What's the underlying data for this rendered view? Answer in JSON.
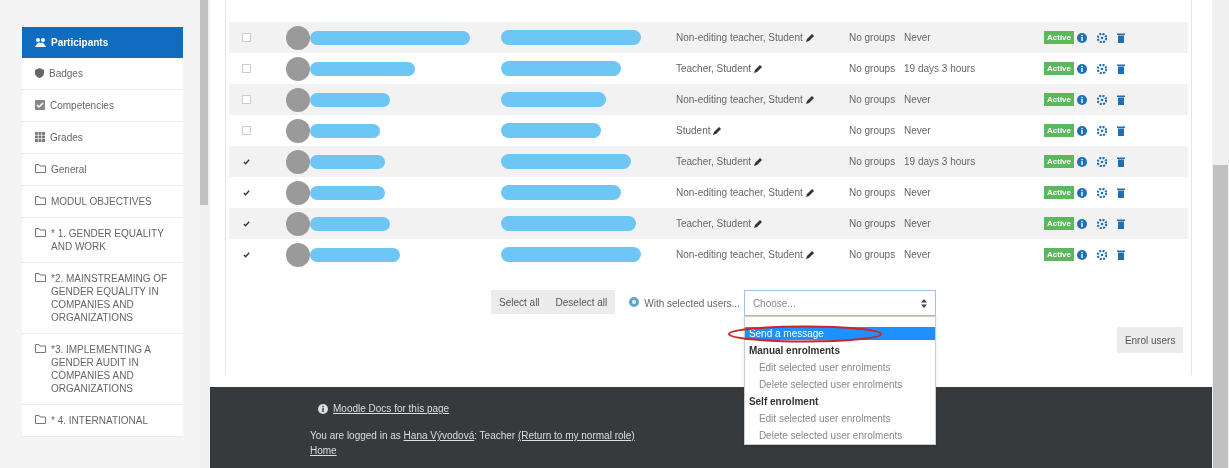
{
  "sidebar": {
    "items": [
      {
        "label": "Participants",
        "kind": "users",
        "selected": true
      },
      {
        "label": "Badges",
        "kind": "badge",
        "selected": false
      },
      {
        "label": "Competencies",
        "kind": "check",
        "selected": false
      },
      {
        "label": "Grades",
        "kind": "table",
        "selected": false
      },
      {
        "label": "General",
        "kind": "folder",
        "selected": false
      },
      {
        "label": "MODUL OBJECTIVES",
        "kind": "folder",
        "selected": false
      },
      {
        "label": "* 1. GENDER EQUALITY AND WORK",
        "kind": "folder",
        "selected": false
      },
      {
        "label": "*2. MAINSTREAMING OF GENDER EQUALITY IN COMPANIES AND ORGANIZATIONS",
        "kind": "folder",
        "selected": false
      },
      {
        "label": "*3. IMPLEMENTING A GENDER AUDIT IN COMPANIES AND ORGANIZATIONS",
        "kind": "folder",
        "selected": false
      },
      {
        "label": "* 4. INTERNATIONAL",
        "kind": "folder",
        "selected": false
      }
    ]
  },
  "participants": {
    "rows": [
      {
        "checked": false,
        "roles": "Non-editing teacher, Student",
        "groups": "No groups",
        "last_access": "Never",
        "status": "Active"
      },
      {
        "checked": false,
        "roles": "Teacher, Student",
        "groups": "No groups",
        "last_access": "19 days 3 hours",
        "status": "Active"
      },
      {
        "checked": false,
        "roles": "Non-editing teacher, Student",
        "groups": "No groups",
        "last_access": "Never",
        "status": "Active"
      },
      {
        "checked": false,
        "roles": "Student",
        "groups": "No groups",
        "last_access": "Never",
        "status": "Active"
      },
      {
        "checked": true,
        "roles": "Teacher, Student",
        "groups": "No groups",
        "last_access": "19 days 3 hours",
        "status": "Active"
      },
      {
        "checked": true,
        "roles": "Non-editing teacher, Student",
        "groups": "No groups",
        "last_access": "Never",
        "status": "Active"
      },
      {
        "checked": true,
        "roles": "Teacher, Student",
        "groups": "No groups",
        "last_access": "Never",
        "status": "Active"
      },
      {
        "checked": true,
        "roles": "Non-editing teacher, Student",
        "groups": "No groups",
        "last_access": "Never",
        "status": "Active"
      }
    ]
  },
  "bulk_actions": {
    "buttons": [
      "Select all",
      "Deselect all"
    ],
    "label": "With selected users...",
    "select": {
      "value": "Choose...",
      "options": [
        {
          "label": "Send a message",
          "kind": "option",
          "selected": true
        },
        {
          "label": "Manual enrolments",
          "kind": "group",
          "selected": false
        },
        {
          "label": "Edit selected user enrolments",
          "kind": "option",
          "selected": false
        },
        {
          "label": "Delete selected user enrolments",
          "kind": "option",
          "selected": false
        },
        {
          "label": "Self enrolment",
          "kind": "group",
          "selected": false
        },
        {
          "label": "Edit selected user enrolments",
          "kind": "option",
          "selected": false
        },
        {
          "label": "Delete selected user enrolments",
          "kind": "option",
          "selected": false
        }
      ]
    }
  },
  "enrol_button": "Enrol users",
  "footer": {
    "docs_link": "Moodle Docs for this page",
    "login_text": [
      {
        "kind": "text",
        "text": "You are logged in as "
      },
      {
        "kind": "link",
        "text": "Hana Vývodová"
      },
      {
        "kind": "text",
        "text": ": Teacher "
      },
      {
        "kind": "link",
        "text": "(Return to my normal role)"
      }
    ],
    "home_link": "Home"
  }
}
